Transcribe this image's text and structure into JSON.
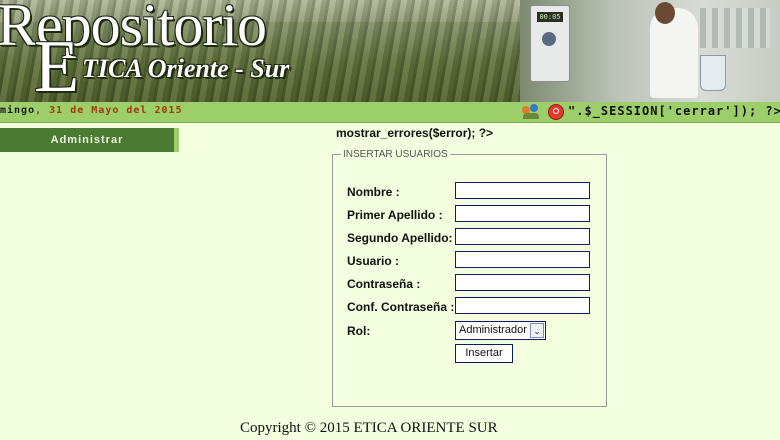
{
  "banner": {
    "logo_main": "Repositorio",
    "logo_e": "E",
    "logo_sub": "TICA Oriente - Sur",
    "device_display": "00:05"
  },
  "header": {
    "date_day": "mingo",
    "date_rest": ", 31 de Mayo del 2015",
    "session_text": "\".$_SESSION['cerrar']); ?>",
    "icons": [
      "users-icon",
      "power-icon"
    ]
  },
  "sidebar": {
    "items": [
      {
        "label": "Administrar"
      }
    ]
  },
  "main": {
    "errors_text": "mostrar_errores($error); ?>",
    "form": {
      "legend": "INSERTAR USUARIOS",
      "fields": [
        {
          "label": "Nombre :",
          "value": ""
        },
        {
          "label": "Primer Apellido :",
          "value": ""
        },
        {
          "label": "Segundo Apellido:",
          "value": ""
        },
        {
          "label": "Usuario :",
          "value": ""
        },
        {
          "label": "Contraseña :",
          "value": ""
        },
        {
          "label": "Conf. Contraseña :",
          "value": ""
        }
      ],
      "role_label": "Rol:",
      "role_selected": "Administrador",
      "submit_label": "Insertar"
    }
  },
  "footer": {
    "copyright": "Copyright © 2015 ETICA ORIENTE SUR"
  },
  "colors": {
    "page_bg": "#f3ffdf",
    "bar_green": "#9ccf6a",
    "sidebar_green": "#4d7a33",
    "date_orange": "#a0380e",
    "input_border": "#101c60"
  }
}
